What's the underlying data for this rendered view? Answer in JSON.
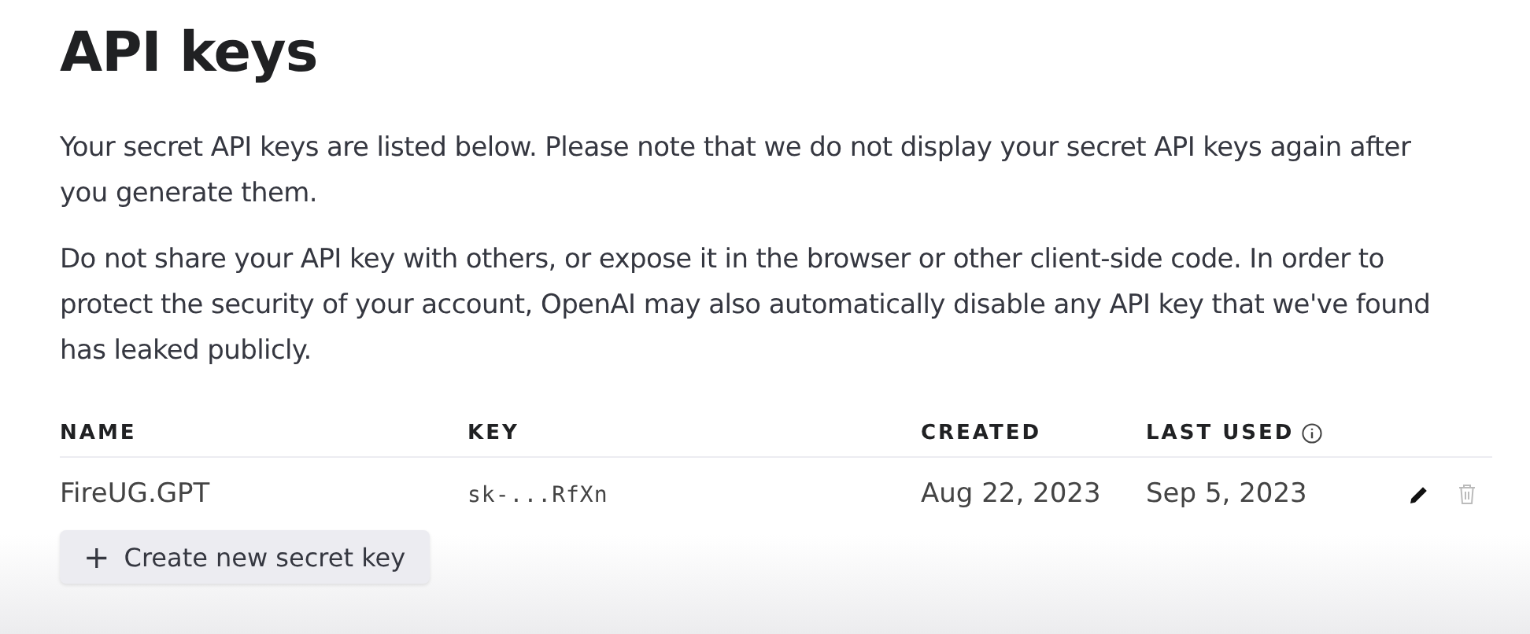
{
  "title": "API keys",
  "paragraphs": [
    "Your secret API keys are listed below. Please note that we do not display your secret API keys again after you generate them.",
    "Do not share your API key with others, or expose it in the browser or other client-side code. In order to protect the security of your account, OpenAI may also automatically disable any API key that we've found has leaked publicly."
  ],
  "table": {
    "columns": [
      {
        "label": "NAME",
        "info": false
      },
      {
        "label": "KEY",
        "info": false
      },
      {
        "label": "CREATED",
        "info": false
      },
      {
        "label": "LAST USED",
        "info": true
      }
    ],
    "rows": [
      {
        "name": "FireUG.GPT",
        "key": "sk-...RfXn",
        "created": "Aug 22, 2023",
        "last_used": "Sep 5, 2023"
      }
    ]
  },
  "create_button": {
    "icon": "+",
    "label": "Create new secret key"
  }
}
